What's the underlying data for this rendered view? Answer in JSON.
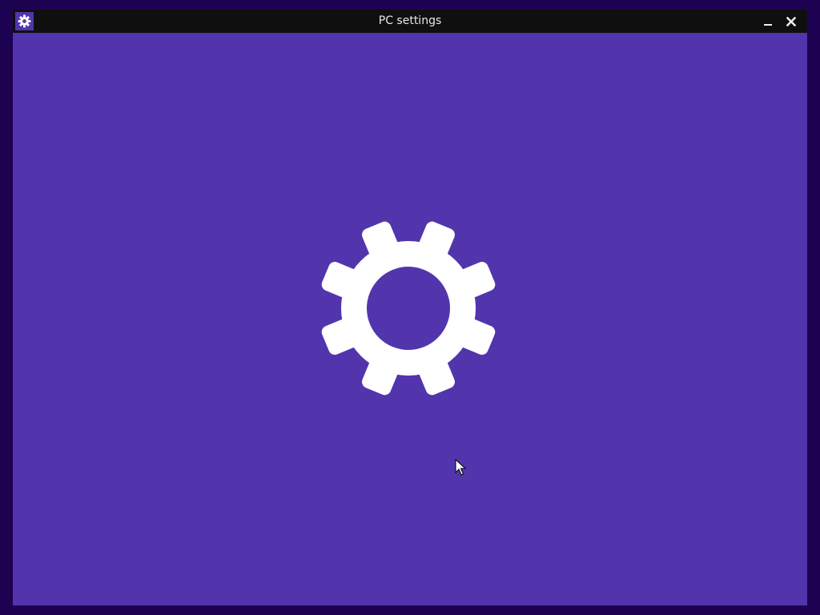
{
  "window": {
    "title": "PC settings",
    "app_icon": "gear-icon",
    "controls": {
      "minimize_icon": "minimize-icon",
      "close_icon": "close-icon"
    }
  },
  "splash": {
    "icon": "gear-icon"
  },
  "colors": {
    "accent": "#5235ad",
    "titlebar": "#0f0f10",
    "frame": "#1e0252",
    "icon_fill": "#ffffff"
  }
}
